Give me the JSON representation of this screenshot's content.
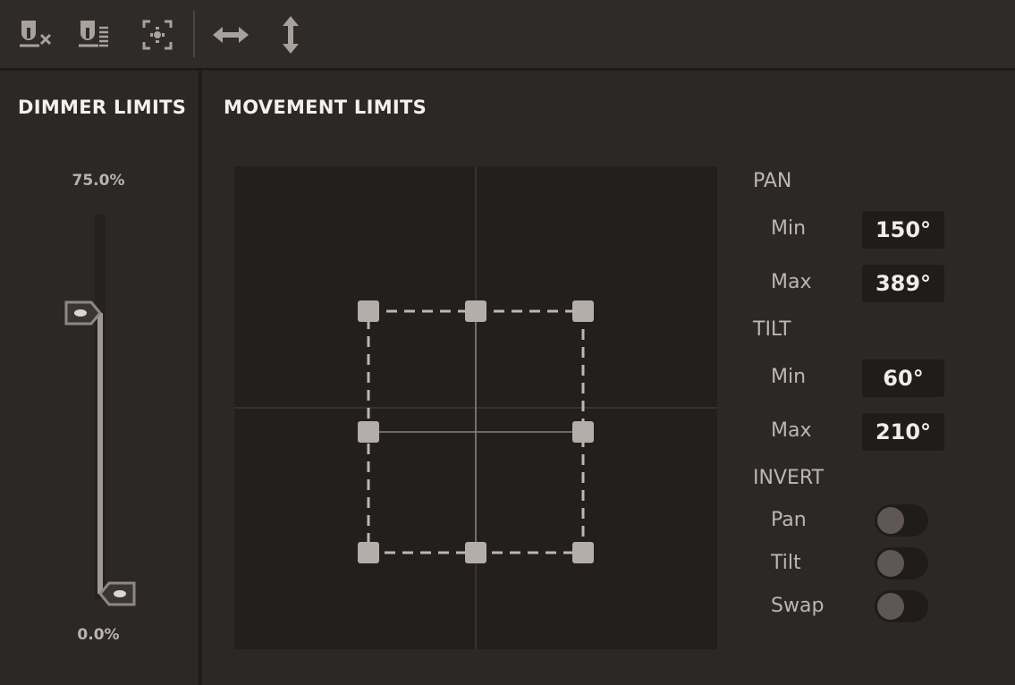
{
  "toolbar": {
    "buttons": [
      {
        "icon": "dimmer-off-icon"
      },
      {
        "icon": "dimmer-levels-icon"
      },
      {
        "icon": "center-focus-icon"
      },
      {
        "icon": "pan-arrows-icon"
      },
      {
        "icon": "tilt-arrows-icon"
      }
    ]
  },
  "dimmer": {
    "title": "DIMMER LIMITS",
    "max_label": "75.0%",
    "min_label": "0.0%",
    "max_value": 0.75,
    "min_value": 0.0
  },
  "movement": {
    "title": "MOVEMENT LIMITS",
    "pan": {
      "heading": "PAN",
      "min_label": "Min",
      "min_value": "150°",
      "max_label": "Max",
      "max_value": "389°"
    },
    "tilt": {
      "heading": "TILT",
      "min_label": "Min",
      "min_value": "60°",
      "max_label": "Max",
      "max_value": "210°"
    },
    "invert": {
      "heading": "INVERT",
      "pan_label": "Pan",
      "pan_on": false,
      "tilt_label": "Tilt",
      "tilt_on": false,
      "swap_label": "Swap",
      "swap_on": false
    }
  },
  "colors": {
    "background": "#2c2826",
    "toolbar": "#2f2b29",
    "xy_area": "#221f1e",
    "handle": "#b5adaa",
    "accent_text": "#f4f0ee"
  }
}
